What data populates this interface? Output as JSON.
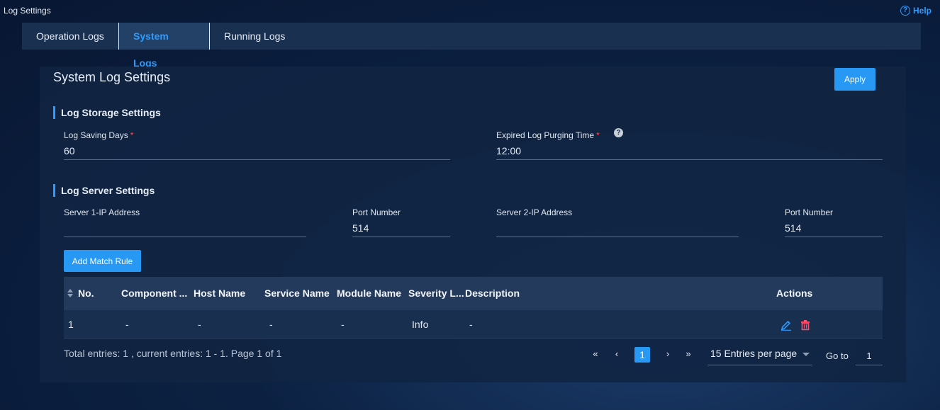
{
  "window": {
    "title": "Log Settings",
    "help_label": "Help"
  },
  "tabs": [
    {
      "label": "Operation Logs"
    },
    {
      "label": "System Logs",
      "active": true
    },
    {
      "label": "Running Logs"
    }
  ],
  "panel": {
    "title": "System Log Settings",
    "apply_label": "Apply"
  },
  "storage": {
    "heading": "Log Storage Settings",
    "saving_days_label": "Log Saving Days",
    "saving_days_value": "60",
    "purge_time_label": "Expired Log Purging Time",
    "purge_time_value": "12:00"
  },
  "server": {
    "heading": "Log Server Settings",
    "server1_label": "Server 1-IP Address",
    "server1_value": "",
    "port1_label": "Port Number",
    "port1_value": "514",
    "server2_label": "Server 2-IP Address",
    "server2_value": "",
    "port2_label": "Port Number",
    "port2_value": "514"
  },
  "rules": {
    "add_label": "Add Match Rule",
    "columns": [
      "No.",
      "Component ...",
      "Host Name",
      "Service Name",
      "Module Name",
      "Severity L...",
      "Description",
      "Actions"
    ],
    "rows": [
      {
        "no": "1",
        "component": "-",
        "host": "-",
        "service": "-",
        "module": "-",
        "severity": "Info",
        "description": "-"
      }
    ]
  },
  "pagination": {
    "summary": "Total entries: 1 , current entries: 1 - 1. Page 1 of 1",
    "current_page": "1",
    "per_page": "15 Entries per page",
    "goto_label": "Go to",
    "goto_value": "1"
  },
  "colors": {
    "accent": "#2898f5",
    "danger": "#ff4d6a",
    "background": "#0c2142"
  },
  "icons": [
    "help-icon",
    "question-icon",
    "sort-icon",
    "edit-icon",
    "delete-icon",
    "first-page-icon",
    "prev-page-icon",
    "next-page-icon",
    "last-page-icon",
    "dropdown-caret-icon"
  ]
}
